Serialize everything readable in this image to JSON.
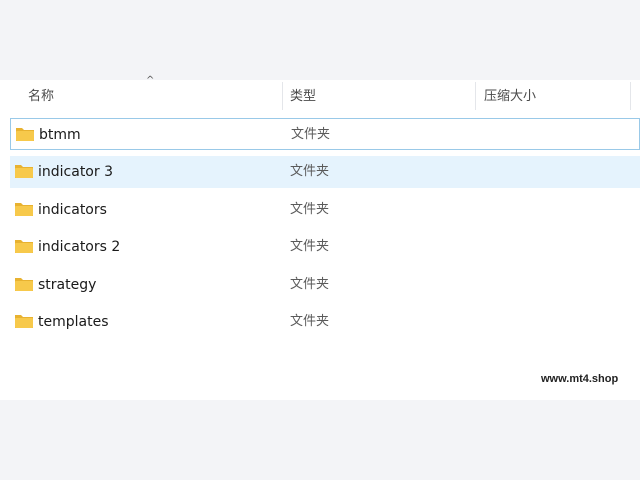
{
  "columns": {
    "name": "名称",
    "type": "类型",
    "compressed_size": "压缩大小",
    "sort_indicator": "^"
  },
  "rows": [
    {
      "name": "btmm",
      "type": "文件夹",
      "state": "selected"
    },
    {
      "name": "indicator 3",
      "type": "文件夹",
      "state": "hover"
    },
    {
      "name": "indicators",
      "type": "文件夹",
      "state": "normal"
    },
    {
      "name": "indicators 2",
      "type": "文件夹",
      "state": "normal"
    },
    {
      "name": "strategy",
      "type": "文件夹",
      "state": "normal"
    },
    {
      "name": "templates",
      "type": "文件夹",
      "state": "normal"
    }
  ],
  "icons": {
    "folder": "folder-icon"
  },
  "colors": {
    "folder_body": "#f7c94b",
    "folder_tab": "#e8b230",
    "selected_border": "#99c9e8",
    "hover_bg": "#e5f3fd"
  },
  "watermark": "www.mt4.shop"
}
